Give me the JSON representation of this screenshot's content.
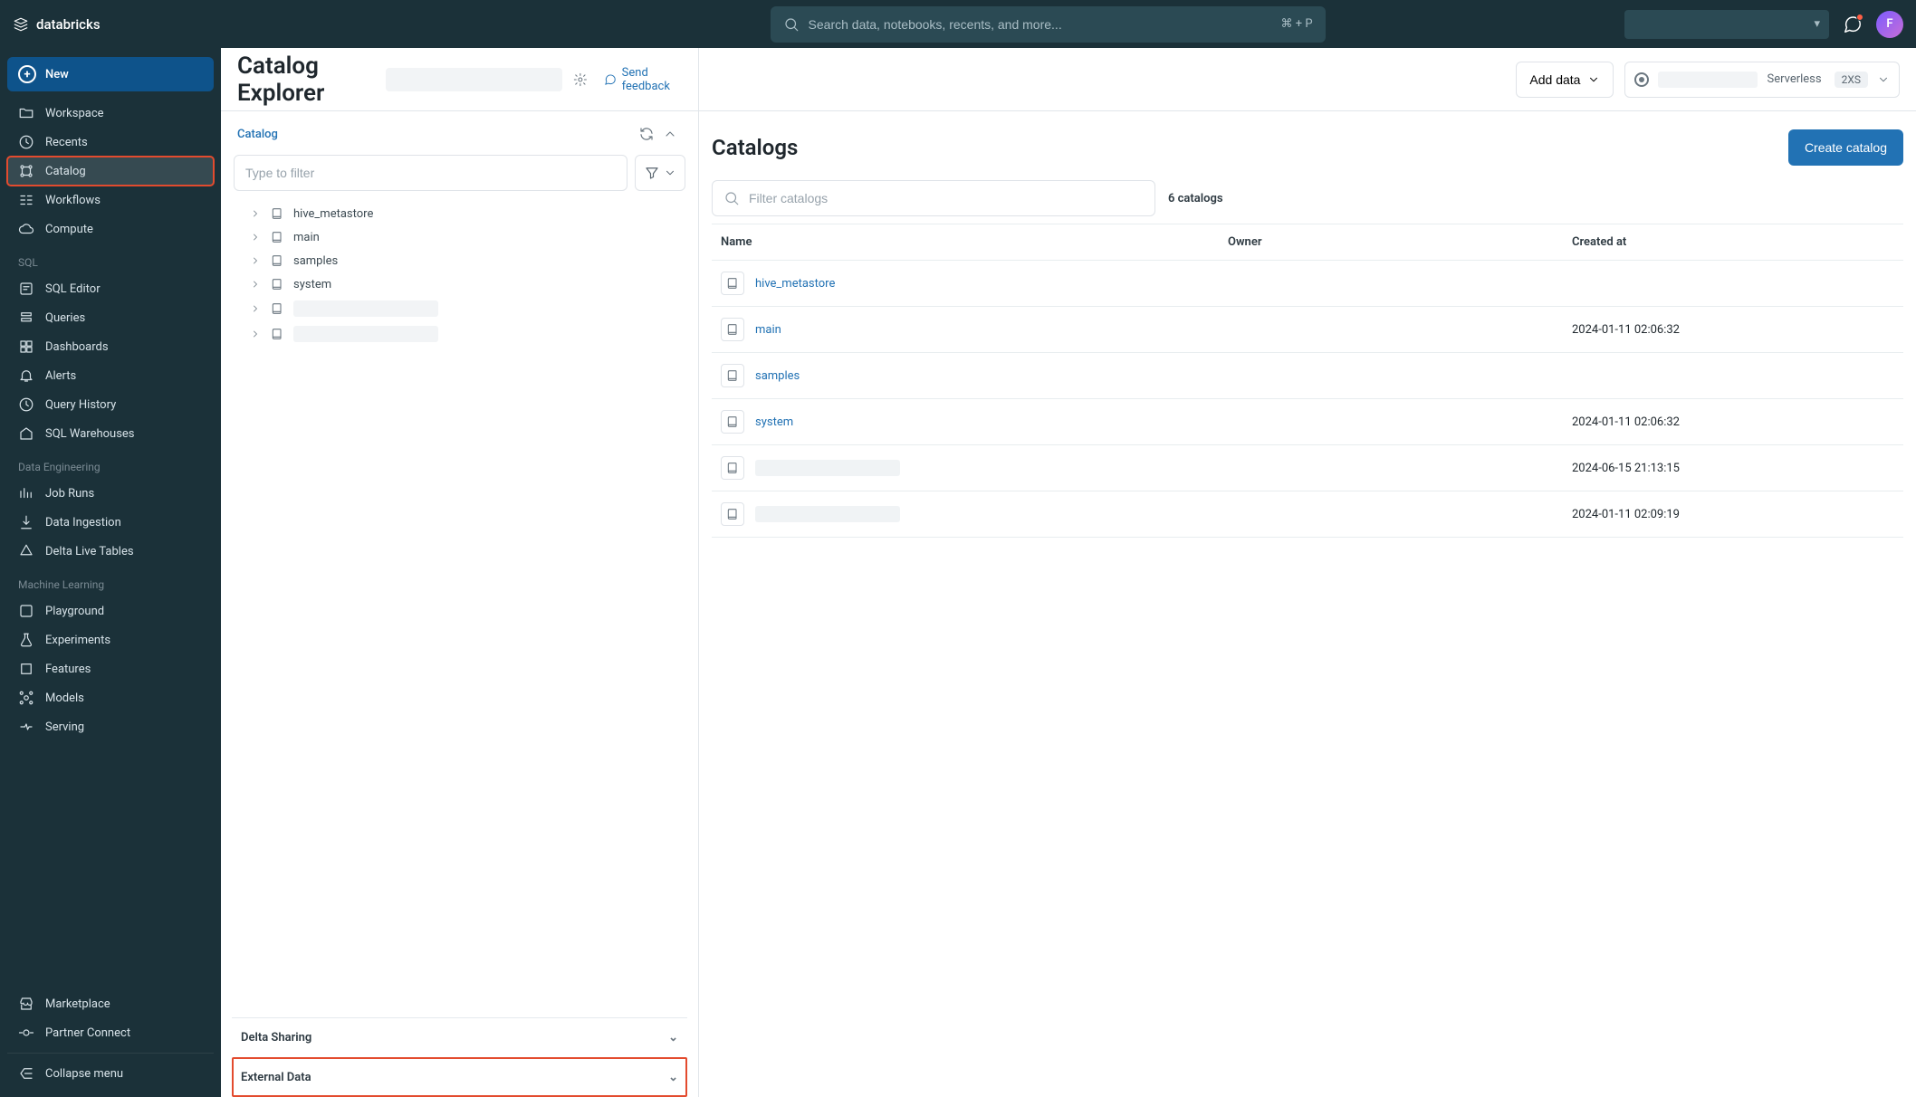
{
  "topbar": {
    "brand": "databricks",
    "search_placeholder": "Search data, notebooks, recents, and more...",
    "search_kbd": "⌘ + P",
    "avatar_initial": "F"
  },
  "leftnav": {
    "new_label": "New",
    "top_items": [
      "Workspace",
      "Recents",
      "Catalog",
      "Workflows",
      "Compute"
    ],
    "sql_label": "SQL",
    "sql_items": [
      "SQL Editor",
      "Queries",
      "Dashboards",
      "Alerts",
      "Query History",
      "SQL Warehouses"
    ],
    "de_label": "Data Engineering",
    "de_items": [
      "Job Runs",
      "Data Ingestion",
      "Delta Live Tables"
    ],
    "ml_label": "Machine Learning",
    "ml_items": [
      "Playground",
      "Experiments",
      "Features",
      "Models",
      "Serving"
    ],
    "bottom_items": [
      "Marketplace",
      "Partner Connect"
    ],
    "collapse_label": "Collapse menu"
  },
  "explorer": {
    "page_title": "Catalog Explorer",
    "feedback_label": "Send feedback",
    "section_label": "Catalog",
    "filter_placeholder": "Type to filter",
    "tree_items": [
      "hive_metastore",
      "main",
      "samples",
      "system"
    ],
    "collapsed_sections": [
      "Delta Sharing",
      "External Data"
    ]
  },
  "header_right": {
    "add_data_label": "Add data",
    "serverless_label": "Serverless",
    "size_label": "2XS"
  },
  "catalogs": {
    "title": "Catalogs",
    "create_label": "Create catalog",
    "filter_placeholder": "Filter catalogs",
    "count_label": "6 catalogs",
    "columns": [
      "Name",
      "Owner",
      "Created at"
    ],
    "rows": [
      {
        "name": "hive_metastore",
        "owner_redacted": false,
        "created": "",
        "link": true
      },
      {
        "name": "main",
        "owner_redacted": true,
        "created": "2024-01-11 02:06:32",
        "link": true
      },
      {
        "name": "samples",
        "owner_redacted": false,
        "created": "",
        "link": true
      },
      {
        "name": "system",
        "owner_redacted": true,
        "created": "2024-01-11 02:06:32",
        "link": true
      },
      {
        "name": "",
        "owner_redacted": true,
        "created": "2024-06-15 21:13:15",
        "link": false
      },
      {
        "name": "",
        "owner_redacted": true,
        "created": "2024-01-11 02:09:19",
        "link": false
      }
    ]
  }
}
